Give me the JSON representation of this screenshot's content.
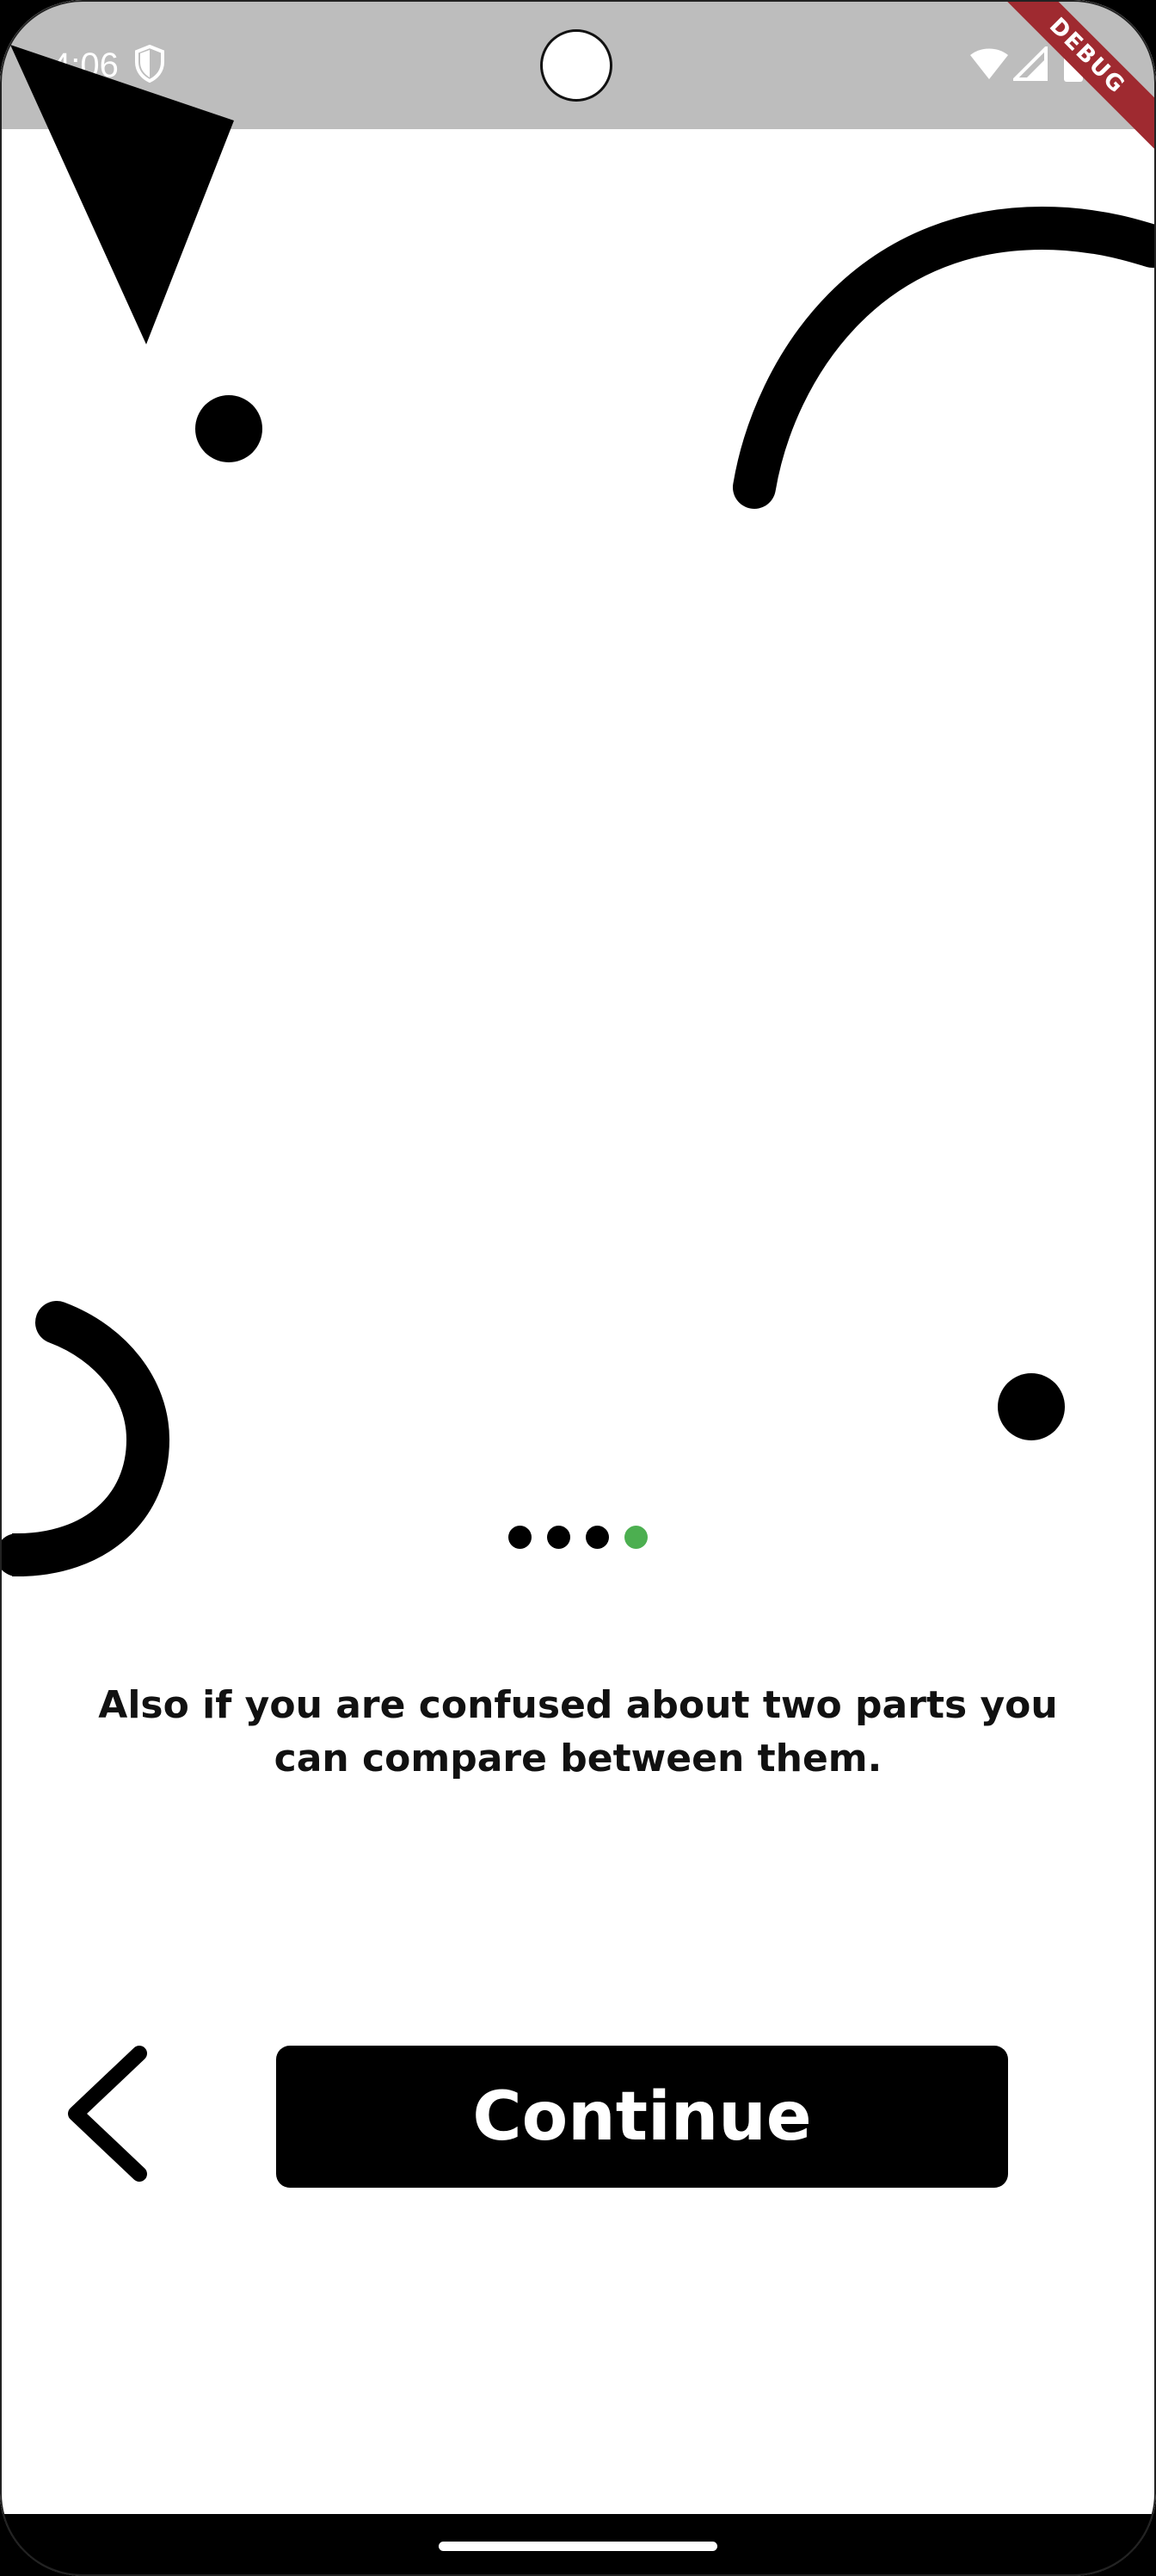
{
  "status_bar": {
    "time": "4:06",
    "icons": [
      "shield-icon",
      "wifi-icon",
      "cellular-signal-icon",
      "battery-icon"
    ]
  },
  "debug_banner": {
    "label": "DEBUG",
    "color": "#9f2a30"
  },
  "onboarding": {
    "page_indicator": {
      "total": 4,
      "current": 4,
      "inactive_color": "#000000",
      "active_color": "#4caf50"
    },
    "description": "Also if you are confused about two parts you can compare between them."
  },
  "actions": {
    "back_icon": "chevron-left-icon",
    "continue_label": "Continue"
  },
  "navigation_bar": {
    "handle": "home-gesture-handle"
  }
}
